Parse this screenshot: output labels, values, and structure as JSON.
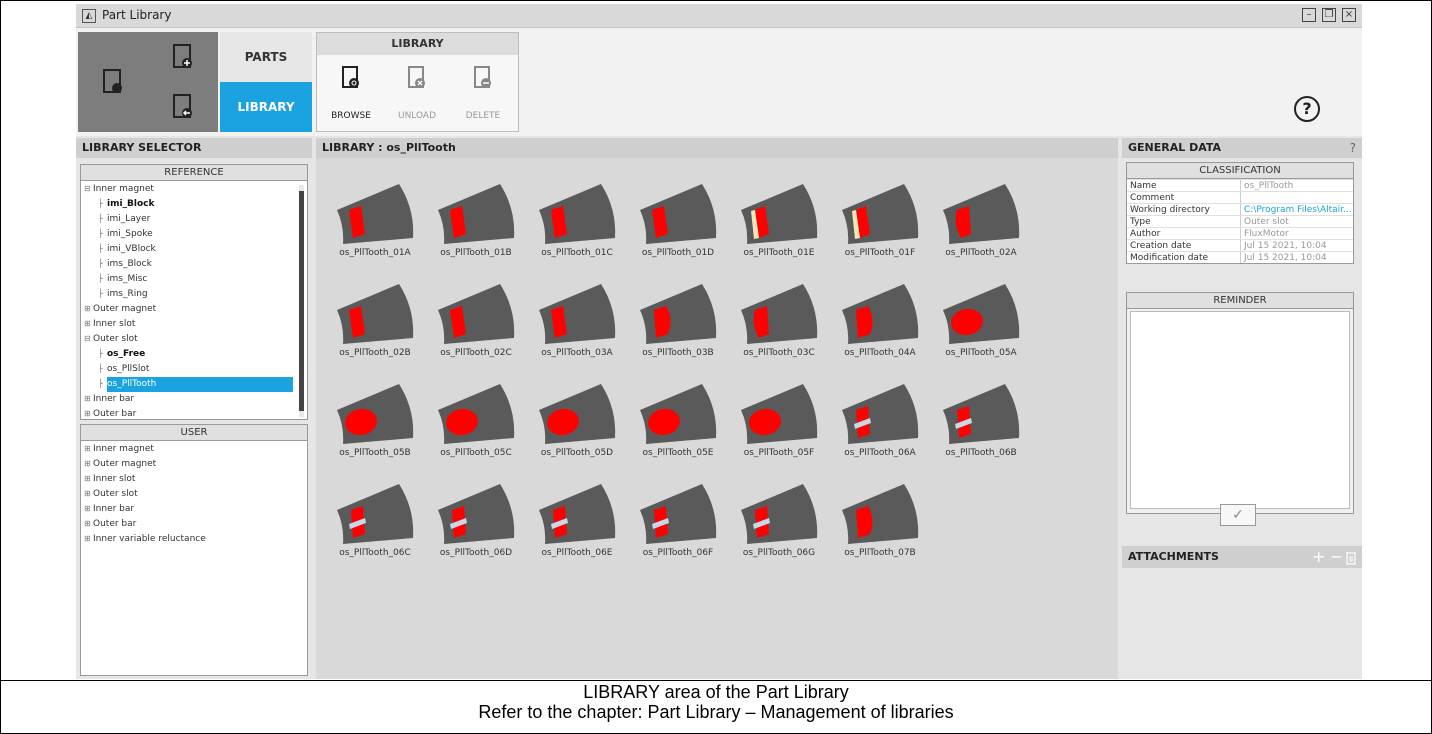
{
  "window": {
    "title": "Part Library",
    "buttons": [
      "minimize",
      "restore",
      "close"
    ]
  },
  "ribbon": {
    "tabs": {
      "parts": "PARTS",
      "library": "LIBRARY",
      "active": "LIBRARY"
    },
    "library_group": {
      "title": "LIBRARY",
      "buttons": [
        {
          "label": "BROWSE",
          "enabled": true,
          "icon": "browse-icon"
        },
        {
          "label": "UNLOAD",
          "enabled": false,
          "icon": "unload-icon"
        },
        {
          "label": "DELETE",
          "enabled": false,
          "icon": "delete-icon"
        }
      ]
    },
    "help": "?"
  },
  "selector": {
    "title": "LIBRARY SELECTOR",
    "reference": {
      "title": "REFERENCE",
      "items": [
        {
          "label": "Inner magnet",
          "level": 0,
          "expanded": true
        },
        {
          "label": "imi_Block",
          "level": 1,
          "bold": true
        },
        {
          "label": "imi_Layer",
          "level": 1
        },
        {
          "label": "imi_Spoke",
          "level": 1
        },
        {
          "label": "imi_VBlock",
          "level": 1
        },
        {
          "label": "ims_Block",
          "level": 1
        },
        {
          "label": "ims_Misc",
          "level": 1
        },
        {
          "label": "ims_Ring",
          "level": 1
        },
        {
          "label": "Outer magnet",
          "level": 0,
          "expanded": false
        },
        {
          "label": "Inner slot",
          "level": 0,
          "expanded": false
        },
        {
          "label": "Outer slot",
          "level": 0,
          "expanded": true
        },
        {
          "label": "os_Free",
          "level": 1,
          "bold": true
        },
        {
          "label": "os_PllSlot",
          "level": 1
        },
        {
          "label": "os_PllTooth",
          "level": 1,
          "selected": true
        },
        {
          "label": "Inner bar",
          "level": 0,
          "expanded": false
        },
        {
          "label": "Outer bar",
          "level": 0,
          "expanded": false
        }
      ]
    },
    "user": {
      "title": "USER",
      "items": [
        "Inner magnet",
        "Outer magnet",
        "Inner slot",
        "Outer slot",
        "Inner bar",
        "Outer bar",
        "Inner variable reluctance"
      ]
    }
  },
  "library": {
    "title": "LIBRARY : os_PllTooth",
    "parts": [
      {
        "name": "os_PllTooth_01A",
        "shape": "rect"
      },
      {
        "name": "os_PllTooth_01B",
        "shape": "rect"
      },
      {
        "name": "os_PllTooth_01C",
        "shape": "rect"
      },
      {
        "name": "os_PllTooth_01D",
        "shape": "rect"
      },
      {
        "name": "os_PllTooth_01E",
        "shape": "rect-light"
      },
      {
        "name": "os_PllTooth_01F",
        "shape": "rect-light"
      },
      {
        "name": "os_PllTooth_02A",
        "shape": "round-left"
      },
      {
        "name": "os_PllTooth_02B",
        "shape": "rect"
      },
      {
        "name": "os_PllTooth_02C",
        "shape": "rect"
      },
      {
        "name": "os_PllTooth_03A",
        "shape": "rect"
      },
      {
        "name": "os_PllTooth_03B",
        "shape": "round-right"
      },
      {
        "name": "os_PllTooth_03C",
        "shape": "round-left"
      },
      {
        "name": "os_PllTooth_04A",
        "shape": "round-right"
      },
      {
        "name": "os_PllTooth_05A",
        "shape": "oval"
      },
      {
        "name": "os_PllTooth_05B",
        "shape": "oval"
      },
      {
        "name": "os_PllTooth_05C",
        "shape": "oval"
      },
      {
        "name": "os_PllTooth_05D",
        "shape": "oval"
      },
      {
        "name": "os_PllTooth_05E",
        "shape": "oval"
      },
      {
        "name": "os_PllTooth_05F",
        "shape": "oval"
      },
      {
        "name": "os_PllTooth_06A",
        "shape": "split"
      },
      {
        "name": "os_PllTooth_06B",
        "shape": "split"
      },
      {
        "name": "os_PllTooth_06C",
        "shape": "split"
      },
      {
        "name": "os_PllTooth_06D",
        "shape": "split"
      },
      {
        "name": "os_PllTooth_06E",
        "shape": "split"
      },
      {
        "name": "os_PllTooth_06F",
        "shape": "split"
      },
      {
        "name": "os_PllTooth_06G",
        "shape": "split"
      },
      {
        "name": "os_PllTooth_07B",
        "shape": "round-right"
      }
    ],
    "colors": {
      "sector": "#5a5a5a",
      "magnet": "#ff0000",
      "insert": "#c8d8e6"
    }
  },
  "general_data": {
    "title": "GENERAL DATA",
    "help": "?",
    "classification": {
      "title": "CLASSIFICATION",
      "rows": [
        {
          "key": "Name",
          "value": "os_PllTooth"
        },
        {
          "key": "Comment",
          "value": ""
        },
        {
          "key": "Working directory",
          "value": "C:\\Program Files\\Altair...",
          "link": true
        },
        {
          "key": "Type",
          "value": "Outer slot"
        },
        {
          "key": "Author",
          "value": "FluxMotor"
        },
        {
          "key": "Creation date",
          "value": "Jul 15 2021, 10:04"
        },
        {
          "key": "Modification date",
          "value": "Jul 15 2021, 10:04"
        }
      ]
    },
    "reminder": {
      "title": "REMINDER",
      "text": ""
    },
    "attachments": {
      "title": "ATTACHMENTS"
    }
  },
  "caption": {
    "line1": "LIBRARY area of the Part Library",
    "line2": "Refer to the chapter: Part Library – Management of libraries"
  },
  "accent_color": "#1aa3e0"
}
